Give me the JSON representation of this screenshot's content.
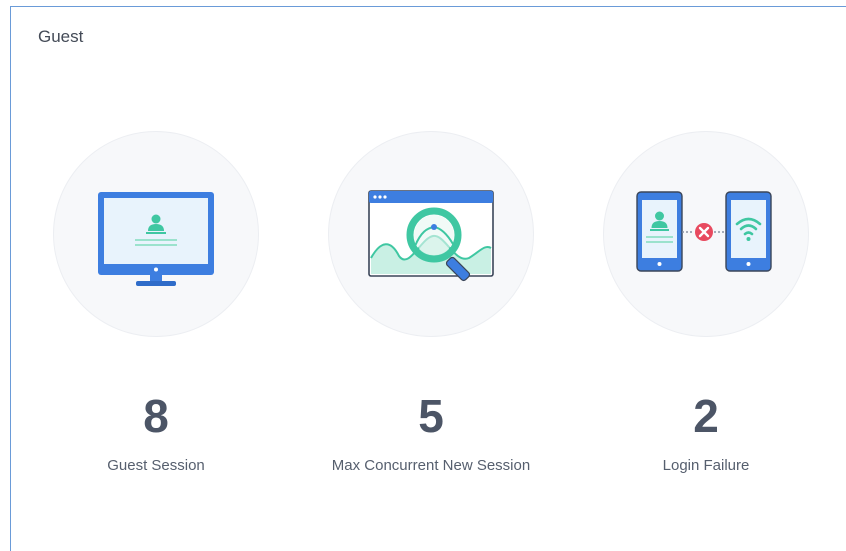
{
  "panel": {
    "title": "Guest"
  },
  "stats": [
    {
      "value": "8",
      "label": "Guest Session",
      "icon": "monitor-user-icon"
    },
    {
      "value": "5",
      "label": "Max Concurrent New Session",
      "icon": "browser-search-icon"
    },
    {
      "value": "2",
      "label": "Login Failure",
      "icon": "phones-connection-failed-icon"
    }
  ],
  "colors": {
    "blue": "#3d7ee0",
    "teal": "#3fc7a2",
    "red": "#e84a5f",
    "text": "#4c5566",
    "circle": "#f7f8fa"
  }
}
